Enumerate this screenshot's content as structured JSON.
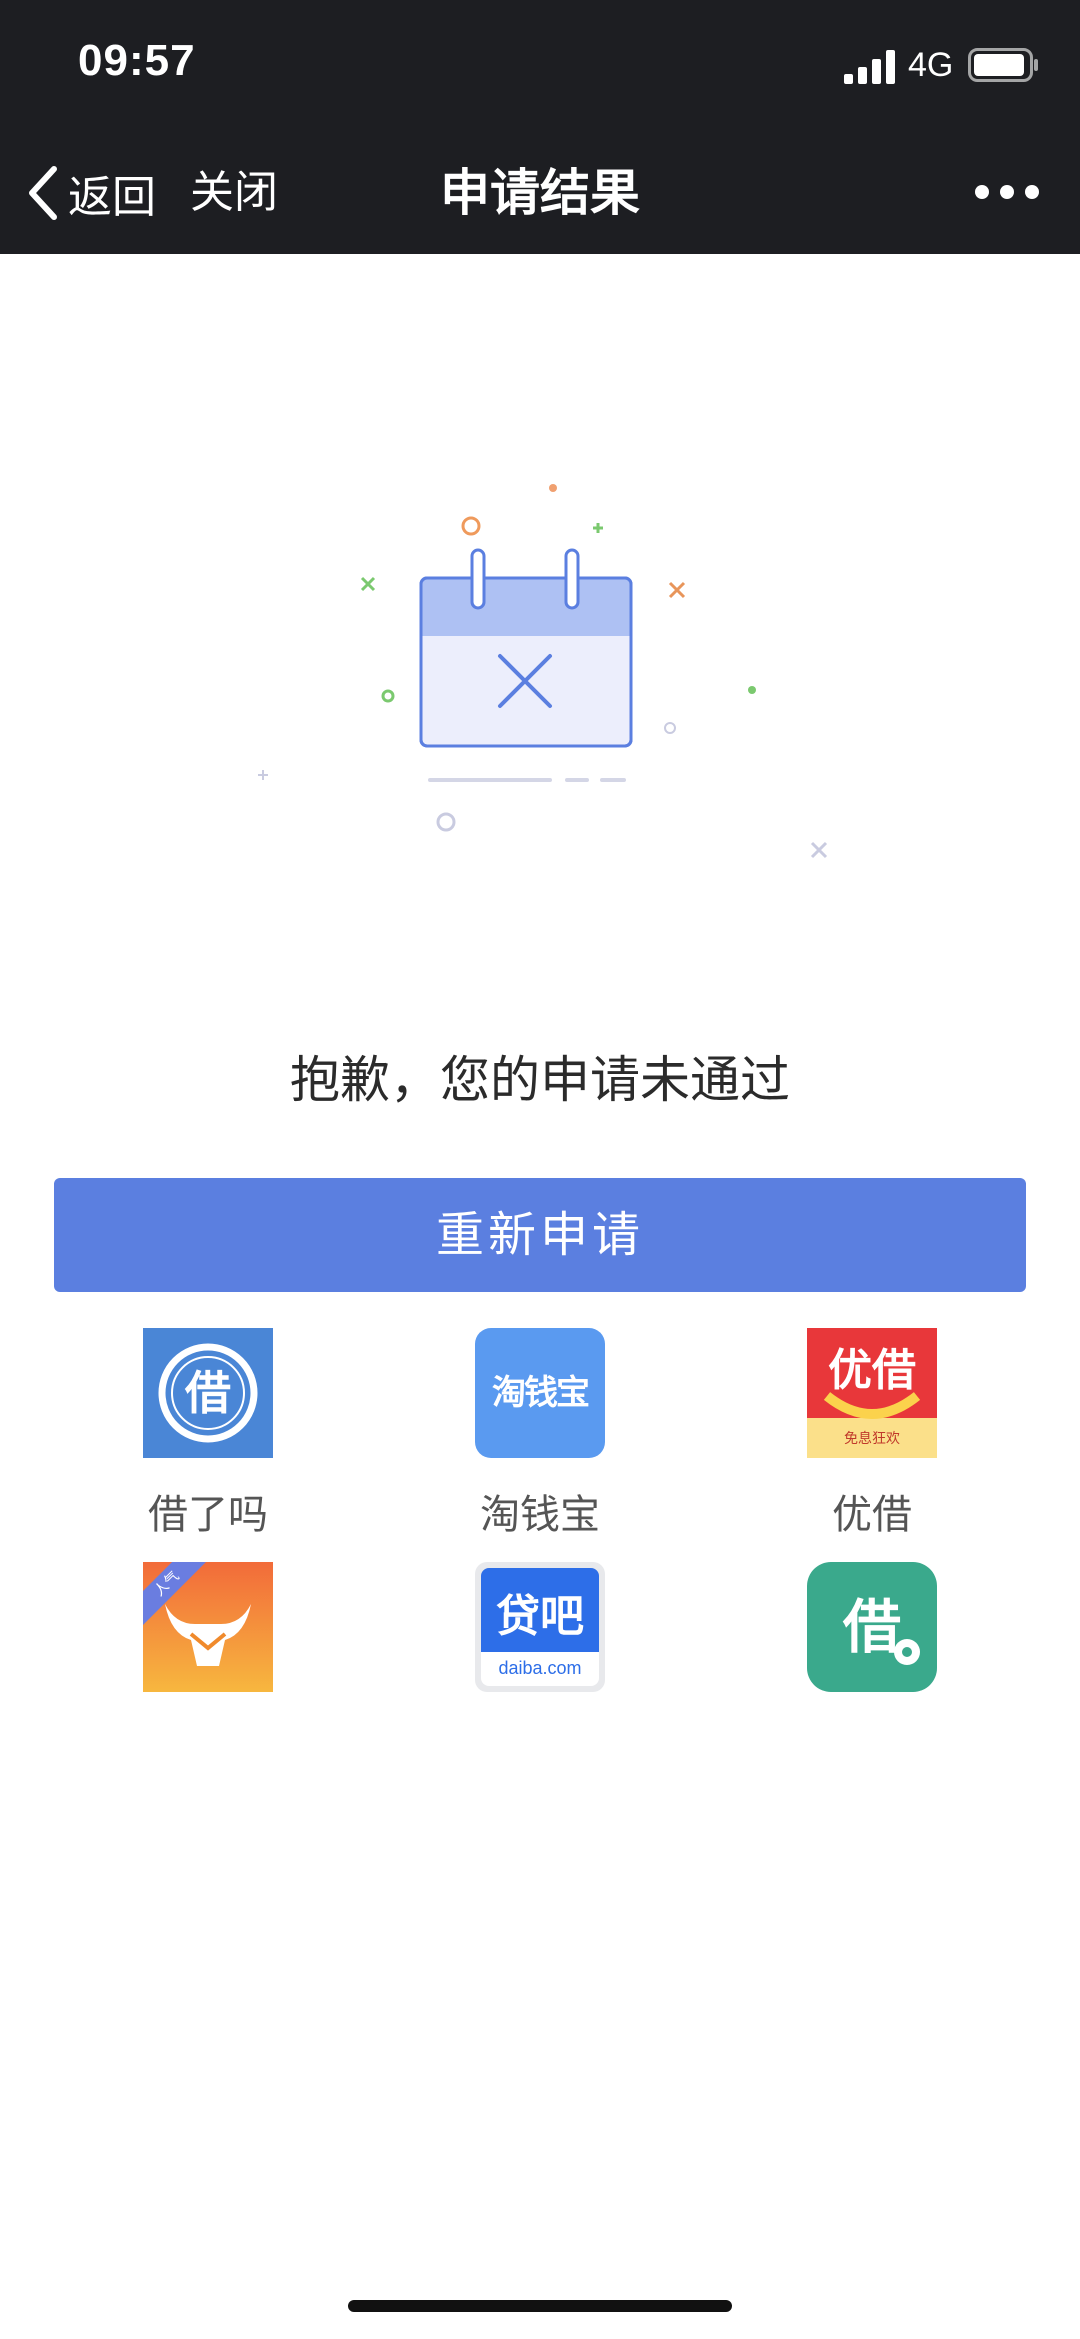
{
  "status_bar": {
    "time": "09:57",
    "network": "4G"
  },
  "nav": {
    "back_label": "返回",
    "close_label": "关闭",
    "title": "申请结果"
  },
  "result": {
    "message": "抱歉，您的申请未通过",
    "reapply_label": "重新申请"
  },
  "apps": [
    {
      "label": "借了吗",
      "icon_text": "借",
      "color": "#4a86d6"
    },
    {
      "label": "淘钱宝",
      "icon_text": "淘钱宝",
      "color": "#5a9af0"
    },
    {
      "label": "优借",
      "icon_text": "优借",
      "icon_subtext": "免息狂欢",
      "color": "#e8373a"
    },
    {
      "label": "",
      "icon_text": "",
      "badge": "人气",
      "color": "#f08a2c"
    },
    {
      "label": "",
      "icon_text": "贷吧",
      "icon_subtext": "daiba.com",
      "color": "#2d6ee8"
    },
    {
      "label": "",
      "icon_text": "借",
      "color": "#3aa98c"
    }
  ],
  "colors": {
    "header_bg": "#1d1e22",
    "primary_button": "#5b7fe0",
    "calendar_outline": "#5b7fe0"
  }
}
